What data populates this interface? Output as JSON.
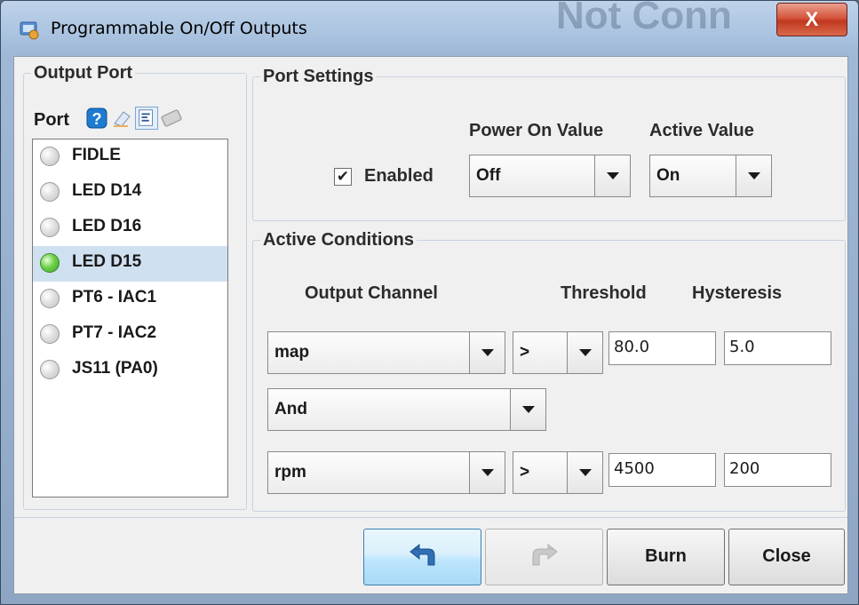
{
  "window": {
    "title": "Programmable On/Off Outputs",
    "background_title_text": "Not Conn",
    "close_glyph": "X"
  },
  "output_port": {
    "group_title": "Output Port",
    "port_label": "Port",
    "toolbar_icons": [
      "help-icon",
      "eraser-icon",
      "properties-icon",
      "chip-icon"
    ],
    "ports": [
      {
        "name": "FIDLE",
        "active": false
      },
      {
        "name": "LED D14",
        "active": false
      },
      {
        "name": "LED D16",
        "active": false
      },
      {
        "name": "LED D15",
        "active": true
      },
      {
        "name": "PT6 - IAC1",
        "active": false
      },
      {
        "name": "PT7 - IAC2",
        "active": false
      },
      {
        "name": "JS11 (PA0)",
        "active": false
      }
    ],
    "selected_port": "LED D15"
  },
  "port_settings": {
    "group_title": "Port Settings",
    "enabled_label": "Enabled",
    "enabled_checked": true,
    "check_glyph": "✔",
    "power_on_label": "Power On Value",
    "power_on_value": "Off",
    "active_value_label": "Active Value",
    "active_value": "On"
  },
  "active_conditions": {
    "group_title": "Active Conditions",
    "col_channel": "Output Channel",
    "col_threshold": "Threshold",
    "col_hysteresis": "Hysteresis",
    "condition1": {
      "channel": "map",
      "operator": ">",
      "threshold": "80.0",
      "hysteresis": "5.0"
    },
    "logic": "And",
    "condition2": {
      "channel": "rpm",
      "operator": ">",
      "threshold": "4500",
      "hysteresis": "200"
    }
  },
  "buttons": {
    "undo_icon": "undo-icon",
    "redo_icon": "redo-icon",
    "burn": "Burn",
    "close": "Close"
  },
  "colors": {
    "selection": "#cfe0f1",
    "led_on": "#6fd04a",
    "close_button": "#c0391f"
  }
}
